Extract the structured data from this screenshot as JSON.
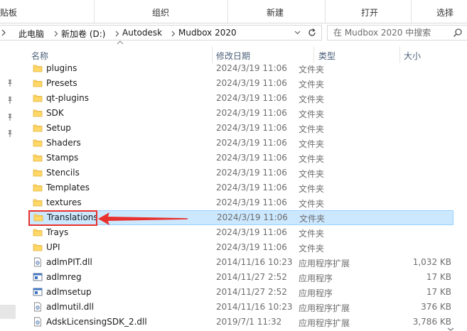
{
  "ribbon": {
    "groups": [
      "贴板",
      "组织",
      "新建",
      "打开",
      "选择"
    ]
  },
  "address": {
    "crumbs": [
      "此电脑",
      "新加卷 (D:)",
      "Autodesk",
      "Mudbox 2020"
    ],
    "search_placeholder": "在 Mudbox 2020 中搜索"
  },
  "columns": {
    "name": "名称",
    "date": "修改日期",
    "type": "类型",
    "size": "大小"
  },
  "files": [
    {
      "name": "plugins",
      "date": "2024/3/19 11:06",
      "type": "文件夹",
      "size": "",
      "icon": "folder-icon"
    },
    {
      "name": "Presets",
      "date": "2024/3/19 11:06",
      "type": "文件夹",
      "size": "",
      "icon": "folder-icon"
    },
    {
      "name": "qt-plugins",
      "date": "2024/3/19 11:06",
      "type": "文件夹",
      "size": "",
      "icon": "folder-icon"
    },
    {
      "name": "SDK",
      "date": "2024/3/19 11:06",
      "type": "文件夹",
      "size": "",
      "icon": "folder-icon"
    },
    {
      "name": "Setup",
      "date": "2024/3/19 11:06",
      "type": "文件夹",
      "size": "",
      "icon": "folder-icon"
    },
    {
      "name": "Shaders",
      "date": "2024/3/19 11:06",
      "type": "文件夹",
      "size": "",
      "icon": "folder-icon"
    },
    {
      "name": "Stamps",
      "date": "2024/3/19 11:06",
      "type": "文件夹",
      "size": "",
      "icon": "folder-icon"
    },
    {
      "name": "Stencils",
      "date": "2024/3/19 11:06",
      "type": "文件夹",
      "size": "",
      "icon": "folder-icon"
    },
    {
      "name": "Templates",
      "date": "2024/3/19 11:06",
      "type": "文件夹",
      "size": "",
      "icon": "folder-icon"
    },
    {
      "name": "textures",
      "date": "2024/3/19 11:06",
      "type": "文件夹",
      "size": "",
      "icon": "folder-icon"
    },
    {
      "name": "Translations",
      "date": "2024/3/19 11:06",
      "type": "文件夹",
      "size": "",
      "icon": "folder-icon",
      "selected": true
    },
    {
      "name": "Trays",
      "date": "2024/3/19 11:06",
      "type": "文件夹",
      "size": "",
      "icon": "folder-icon"
    },
    {
      "name": "UPI",
      "date": "2024/3/19 11:06",
      "type": "文件夹",
      "size": "",
      "icon": "folder-icon"
    },
    {
      "name": "adlmPIT.dll",
      "date": "2014/11/16 10:23",
      "type": "应用程序扩展",
      "size": "1,032 KB",
      "icon": "dll-icon"
    },
    {
      "name": "adlmreg",
      "date": "2014/11/27 2:52",
      "type": "应用程序",
      "size": "17 KB",
      "icon": "exe-icon"
    },
    {
      "name": "adlmsetup",
      "date": "2014/11/27 2:52",
      "type": "应用程序",
      "size": "17 KB",
      "icon": "exe-icon"
    },
    {
      "name": "adlmutil.dll",
      "date": "2014/11/16 10:23",
      "type": "应用程序扩展",
      "size": "376 KB",
      "icon": "dll-icon"
    },
    {
      "name": "AdskLicensingSDK_2.dll",
      "date": "2019/7/1 11:32",
      "type": "应用程序扩展",
      "size": "3,786 KB",
      "icon": "dll-icon"
    }
  ],
  "colors": {
    "selection_bg": "#cce8ff",
    "selection_border": "#99d1ff",
    "annotation_red": "#e8302c",
    "folder_yellow": "#ffd867"
  }
}
